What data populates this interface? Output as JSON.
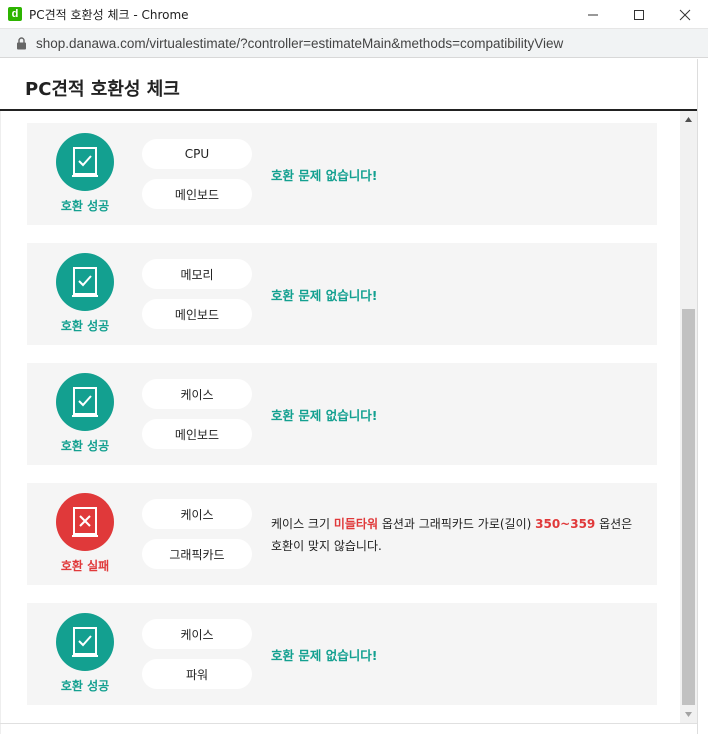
{
  "window": {
    "app_icon": "d",
    "title": "PC견적 호환성 체크 - Chrome",
    "controls": [
      "minimize-icon",
      "maximize-icon",
      "close-icon"
    ]
  },
  "address": {
    "url": "shop.danawa.com/virtualestimate/?controller=estimateMain&methods=compatibilityView"
  },
  "page": {
    "title": "PC견적 호환성 체크"
  },
  "colors": {
    "success": "#13a090",
    "fail": "#e0393a"
  },
  "checks": [
    {
      "status": "ok",
      "status_label": "호환 성공",
      "part1": "CPU",
      "part2": "메인보드",
      "message": "호환 문제 없습니다!"
    },
    {
      "status": "ok",
      "status_label": "호환 성공",
      "part1": "메모리",
      "part2": "메인보드",
      "message": "호환 문제 없습니다!"
    },
    {
      "status": "ok",
      "status_label": "호환 성공",
      "part1": "케이스",
      "part2": "메인보드",
      "message": "호환 문제 없습니다!"
    },
    {
      "status": "fail",
      "status_label": "호환 실패",
      "part1": "케이스",
      "part2": "그래픽카드",
      "message_parts": {
        "t1": "케이스 크기 ",
        "h1": "미들타워",
        "t2": " 옵션과 그래픽카드 가로(길이) ",
        "h2": "350~359",
        "t3": " 옵션은 호환이 맞지 않습니다."
      }
    },
    {
      "status": "ok",
      "status_label": "호환 성공",
      "part1": "케이스",
      "part2": "파워",
      "message": "호환 문제 없습니다!"
    }
  ]
}
